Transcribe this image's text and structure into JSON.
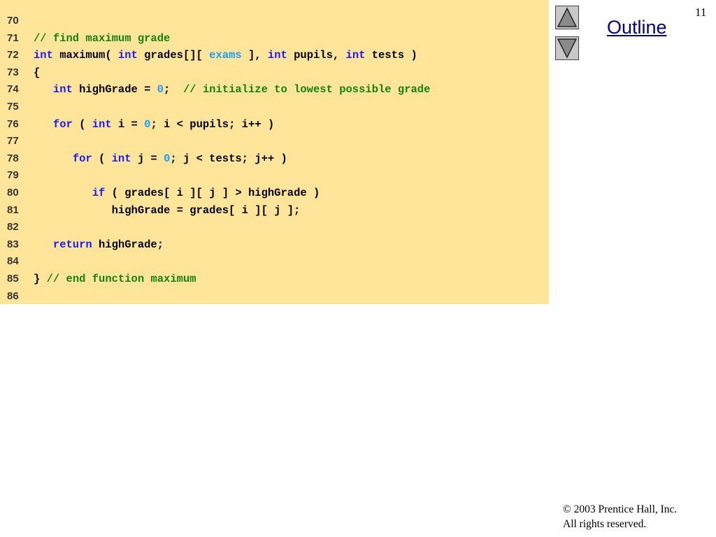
{
  "slide": {
    "number": "11",
    "outline_label": "Outline",
    "copyright_symbol": "©",
    "copyright_text": " 2003 Prentice Hall, Inc.",
    "rights_text": "All rights reserved."
  },
  "colors": {
    "code_background": "#ffe599",
    "keyword": "#1a1aff",
    "comment": "#11840e",
    "literal": "#1a9cff",
    "text": "#000000",
    "outline_link": "#000080"
  },
  "icons": {
    "up": "triangle-up-icon",
    "down": "triangle-down-icon"
  },
  "code": [
    {
      "num": "70",
      "tokens": []
    },
    {
      "num": "71",
      "tokens": [
        {
          "t": "cm",
          "v": "// find maximum grade"
        }
      ]
    },
    {
      "num": "72",
      "tokens": [
        {
          "t": "kw",
          "v": "int"
        },
        {
          "t": "tx",
          "v": " maximum( "
        },
        {
          "t": "kw",
          "v": "int"
        },
        {
          "t": "tx",
          "v": " grades[][ "
        },
        {
          "t": "id",
          "v": "exams"
        },
        {
          "t": "tx",
          "v": " ], "
        },
        {
          "t": "kw",
          "v": "int"
        },
        {
          "t": "tx",
          "v": " pupils, "
        },
        {
          "t": "kw",
          "v": "int"
        },
        {
          "t": "tx",
          "v": " tests )"
        }
      ]
    },
    {
      "num": "73",
      "tokens": [
        {
          "t": "tx",
          "v": "{"
        }
      ]
    },
    {
      "num": "74",
      "tokens": [
        {
          "t": "tx",
          "v": "   "
        },
        {
          "t": "kw",
          "v": "int"
        },
        {
          "t": "tx",
          "v": " highGrade = "
        },
        {
          "t": "num",
          "v": "0"
        },
        {
          "t": "tx",
          "v": ";  "
        },
        {
          "t": "cm",
          "v": "// initialize to lowest possible grade"
        }
      ]
    },
    {
      "num": "75",
      "tokens": []
    },
    {
      "num": "76",
      "tokens": [
        {
          "t": "tx",
          "v": "   "
        },
        {
          "t": "kw",
          "v": "for"
        },
        {
          "t": "tx",
          "v": " ( "
        },
        {
          "t": "kw",
          "v": "int"
        },
        {
          "t": "tx",
          "v": " i = "
        },
        {
          "t": "num",
          "v": "0"
        },
        {
          "t": "tx",
          "v": "; i < pupils; i++ )"
        }
      ]
    },
    {
      "num": "77",
      "tokens": []
    },
    {
      "num": "78",
      "tokens": [
        {
          "t": "tx",
          "v": "      "
        },
        {
          "t": "kw",
          "v": "for"
        },
        {
          "t": "tx",
          "v": " ( "
        },
        {
          "t": "kw",
          "v": "int"
        },
        {
          "t": "tx",
          "v": " j = "
        },
        {
          "t": "num",
          "v": "0"
        },
        {
          "t": "tx",
          "v": "; j < tests; j++ )"
        }
      ]
    },
    {
      "num": "79",
      "tokens": []
    },
    {
      "num": "80",
      "tokens": [
        {
          "t": "tx",
          "v": "         "
        },
        {
          "t": "kw",
          "v": "if"
        },
        {
          "t": "tx",
          "v": " ( grades[ i ][ j ] > highGrade )"
        }
      ]
    },
    {
      "num": "81",
      "tokens": [
        {
          "t": "tx",
          "v": "            highGrade = grades[ i ][ j ];"
        }
      ]
    },
    {
      "num": "82",
      "tokens": []
    },
    {
      "num": "83",
      "tokens": [
        {
          "t": "tx",
          "v": "   "
        },
        {
          "t": "kw",
          "v": "return"
        },
        {
          "t": "tx",
          "v": " highGrade;"
        }
      ]
    },
    {
      "num": "84",
      "tokens": []
    },
    {
      "num": "85",
      "tokens": [
        {
          "t": "tx",
          "v": "} "
        },
        {
          "t": "cm",
          "v": "// end function maximum"
        }
      ]
    },
    {
      "num": "86",
      "tokens": []
    }
  ]
}
